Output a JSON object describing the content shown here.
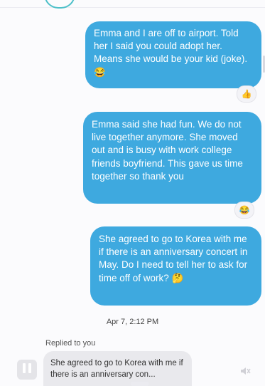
{
  "messages": [
    {
      "text": "Emma and I are off to airport. Told her I said you could adopt her. Means she would be your kid (joke). 😂",
      "reaction": "👍"
    },
    {
      "text": "Emma said she had fun. We do not live together anymore. She moved out and is busy with work college friends boyfriend. This gave us time together so thank you",
      "reaction": "😂"
    },
    {
      "text": "She agreed to go to Korea with me if there is an anniversary concert in May. Do I need to tell her to ask for time off of work? 🤔"
    }
  ],
  "timestamp": "Apr 7, 2:12 PM",
  "reply": {
    "label": "Replied to you",
    "quote": "She agreed to go to Korea with me if there is an anniversary con..."
  },
  "colors": {
    "bubble": "#3ea9df",
    "background": "#fbfbfd"
  },
  "icons": {
    "pause": "pause-icon",
    "mute": "mute-icon"
  }
}
